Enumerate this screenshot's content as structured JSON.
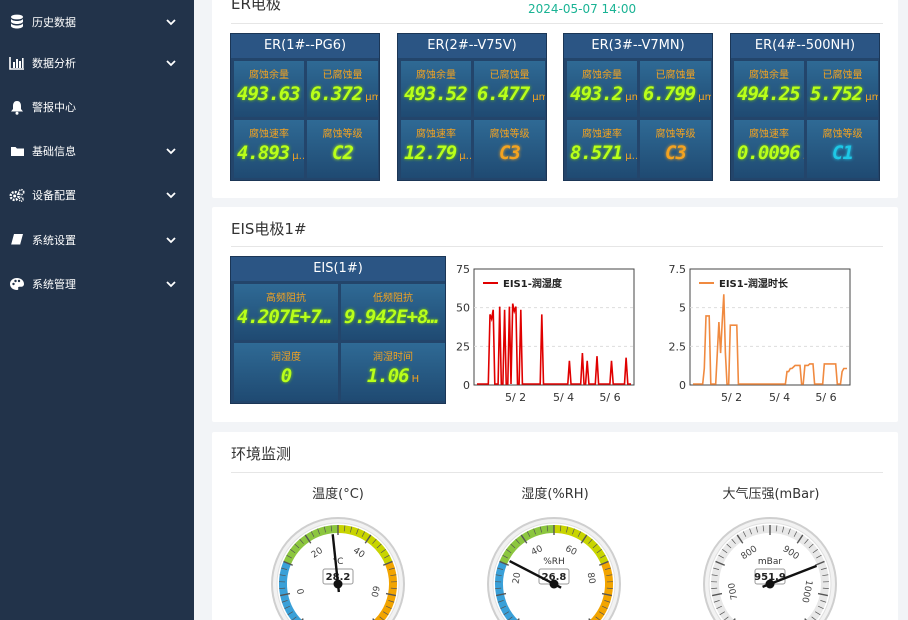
{
  "sidebar": {
    "items": [
      {
        "label": "历史数据",
        "icon": "database-icon"
      },
      {
        "label": "数据分析",
        "icon": "bar-chart-icon"
      },
      {
        "label": "警报中心",
        "icon": "bell-icon"
      },
      {
        "label": "基础信息",
        "icon": "folder-icon"
      },
      {
        "label": "设备配置",
        "icon": "gears-icon"
      },
      {
        "label": "系统设置",
        "icon": "book-icon"
      },
      {
        "label": "系统管理",
        "icon": "palette-icon"
      }
    ]
  },
  "er_panel": {
    "title": "ER电极",
    "timestamp": "2024-05-07 14:00",
    "timestamp_color": "#1ab394",
    "tiles": [
      {
        "name": "ER(1#--PG6)",
        "remaining": "493.63",
        "corroded": "6.372",
        "corroded_unit": "μm",
        "rate": "4.893",
        "rate_unit": "μ…",
        "grade": "C2"
      },
      {
        "name": "ER(2#--V75V)",
        "remaining": "493.52",
        "corroded": "6.477",
        "corroded_unit": "μm",
        "rate": "12.79",
        "rate_unit": "μ…",
        "grade": "C3"
      },
      {
        "name": "ER(3#--V7MN)",
        "remaining": "493.2",
        "remaining_unit": "μm",
        "corroded": "6.799",
        "corroded_unit": "μm",
        "rate": "8.571",
        "rate_unit": "μ…",
        "grade": "C3"
      },
      {
        "name": "ER(4#--500NH)",
        "remaining": "494.25",
        "corroded": "5.752",
        "corroded_unit": "μm",
        "rate": "0.0096",
        "rate_unit": "…",
        "grade": "C1"
      }
    ],
    "labels": {
      "remaining": "腐蚀余量",
      "corroded": "已腐蚀量",
      "rate": "腐蚀速率",
      "grade": "腐蚀等级"
    },
    "grade_colors": {
      "C1": "#1ec8e6",
      "C2": "#b9ff1a",
      "C3": "#f4a320"
    }
  },
  "eis_panel": {
    "title": "EIS电极1#",
    "tile": {
      "name": "EIS(1#)",
      "labels": {
        "high": "高频阻抗",
        "low": "低频阻抗",
        "wet": "润湿度",
        "wet_time": "润湿时间"
      },
      "high": "4.207E+7…",
      "low": "9.942E+8…",
      "wet": "0",
      "wet_time": "1.06",
      "wet_time_unit": "H"
    }
  },
  "chart_data": [
    {
      "type": "line",
      "series": [
        {
          "name": "EIS1-润湿度",
          "color": "#e00000",
          "values": [
            0,
            0,
            0,
            0,
            0,
            0,
            0,
            0,
            45,
            42,
            48,
            0,
            0,
            0,
            50,
            0,
            0,
            48,
            0,
            0,
            50,
            0,
            52,
            47,
            50,
            0,
            0,
            48,
            0,
            0,
            0,
            0,
            0,
            0,
            0,
            0,
            0,
            0,
            0,
            0,
            45,
            0,
            0,
            0,
            0,
            0,
            0,
            0,
            0,
            0,
            0,
            0,
            0,
            0,
            0,
            0,
            0,
            15,
            0,
            0,
            0,
            0,
            0,
            0,
            0,
            20,
            0,
            0,
            15,
            0,
            0,
            0,
            0,
            0,
            18,
            0,
            0,
            0,
            0,
            0,
            0,
            0,
            0,
            15,
            0,
            0,
            0,
            0,
            0,
            0,
            0,
            0,
            17,
            0,
            0,
            0
          ]
        }
      ],
      "x_ticks": [
        "5/ 2",
        "5/ 4",
        "5/ 6"
      ],
      "y_ticks": [
        "0",
        "25",
        "50",
        "75"
      ],
      "ylim": [
        0,
        75
      ]
    },
    {
      "type": "line",
      "series": [
        {
          "name": "EIS1-润湿时长",
          "color": "#f08a40",
          "values": [
            0,
            0,
            0,
            0,
            0,
            0,
            0,
            1,
            4.4,
            4.4,
            4.4,
            0,
            0,
            0,
            0,
            2,
            4,
            2,
            4,
            5.8,
            2,
            0,
            0,
            3.8,
            3.8,
            3.8,
            3.8,
            3.8,
            0,
            0,
            0,
            0,
            0,
            0,
            0,
            0,
            0,
            0,
            0,
            0,
            0,
            0,
            0,
            0,
            0,
            0,
            0,
            0,
            0,
            0,
            0,
            0,
            0,
            0,
            0,
            0,
            0,
            0,
            0.8,
            0.8,
            1,
            1,
            1.1,
            1.2,
            1.2,
            1.2,
            1.2,
            0,
            0,
            1.2,
            1.2,
            1.2,
            1.3,
            1.3,
            1.3,
            0,
            0,
            0,
            0,
            0,
            0,
            1.3,
            1.3,
            1.3,
            1.3,
            1.3,
            1.3,
            1.3,
            1.3,
            0,
            0,
            0,
            0.8,
            1,
            1,
            1
          ]
        }
      ],
      "x_ticks": [
        "5/ 2",
        "5/ 4",
        "5/ 6"
      ],
      "y_ticks": [
        "0",
        "2.5",
        "5",
        "7.5"
      ],
      "ylim": [
        0,
        7.5
      ]
    }
  ],
  "env_panel": {
    "title": "环境监测",
    "gauges": [
      {
        "title": "温度(°C)",
        "unit": "°C",
        "value": "28.2",
        "value_num": 28.2,
        "min": -10,
        "max": 70,
        "ticks": [
          "0",
          "20",
          "40",
          "60"
        ],
        "colors": [
          "#3aa0d8",
          "#8cc63f",
          "#c8d400",
          "#f2a400"
        ]
      },
      {
        "title": "湿度(%RH)",
        "unit": "%RH",
        "value": "26.8",
        "value_num": 26.8,
        "min": 0,
        "max": 100,
        "ticks": [
          "20",
          "40",
          "60",
          "80"
        ],
        "colors": [
          "#3aa0d8",
          "#8cc63f",
          "#c8d400",
          "#f2a400"
        ]
      },
      {
        "title": "大气压强(mBar)",
        "unit": "mBar",
        "value": "951.9",
        "value_num": 951.9,
        "min": 650,
        "max": 1050,
        "ticks": [
          "700",
          "800",
          "900",
          "1000"
        ],
        "colors": [
          "#e8e8e8"
        ]
      }
    ]
  }
}
